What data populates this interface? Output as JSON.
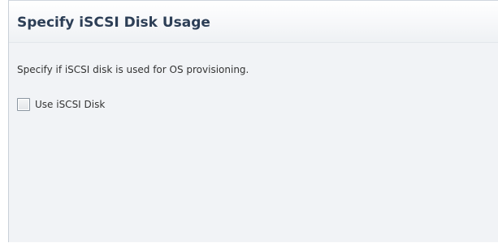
{
  "panel": {
    "title": "Specify iSCSI Disk Usage",
    "description": "Specify if iSCSI disk is used for OS provisioning.",
    "checkbox": {
      "label": "Use iSCSI Disk",
      "checked": false
    }
  },
  "colors": {
    "title_text": "#2c3e56",
    "panel_background": "#f1f3f6",
    "body_text": "#333333"
  }
}
